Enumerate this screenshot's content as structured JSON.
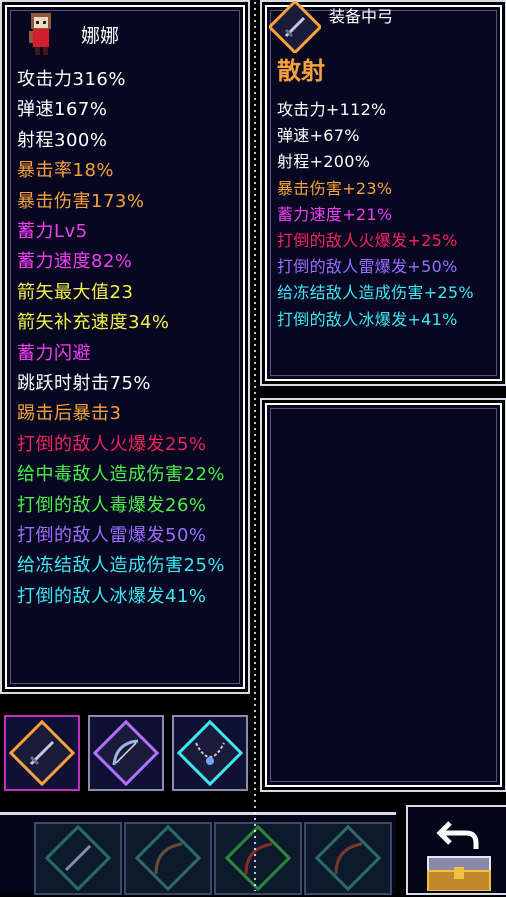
{
  "character": {
    "name": "娜娜",
    "stats": [
      {
        "text": "攻击力316%",
        "color": "#ffffff"
      },
      {
        "text": "弹速167%",
        "color": "#ffffff"
      },
      {
        "text": "射程300%",
        "color": "#ffffff"
      },
      {
        "text": "暴击率18%",
        "color": "#f6a13c"
      },
      {
        "text": "暴击伤害173%",
        "color": "#f6a13c"
      },
      {
        "text": "蓄力Lv5",
        "color": "#f03ef0"
      },
      {
        "text": "蓄力速度82%",
        "color": "#f03ef0"
      },
      {
        "text": "箭矢最大值23",
        "color": "#f4f04a"
      },
      {
        "text": "箭矢补充速度34%",
        "color": "#f4f04a"
      },
      {
        "text": "蓄力闪避",
        "color": "#f03ef0"
      },
      {
        "text": "跳跃时射击75%",
        "color": "#ffffff"
      },
      {
        "text": "踢击后暴击3",
        "color": "#f6a13c"
      },
      {
        "text": "打倒的敌人火爆发25%",
        "color": "#f0245a"
      },
      {
        "text": "给中毒敌人造成伤害22%",
        "color": "#4cf04a"
      },
      {
        "text": "打倒的敌人毒爆发26%",
        "color": "#4cf04a"
      },
      {
        "text": "打倒的敌人雷爆发50%",
        "color": "#9a6cff"
      },
      {
        "text": "给冻结敌人造成伤害25%",
        "color": "#3ee6ee"
      },
      {
        "text": "打倒的敌人冰爆发41%",
        "color": "#3ee6ee"
      }
    ]
  },
  "equipped": {
    "label": "装备中弓",
    "title": "散射",
    "icon": "sword-icon",
    "stats": [
      {
        "text": "攻击力+112%",
        "color": "#ffffff"
      },
      {
        "text": "弹速+67%",
        "color": "#ffffff"
      },
      {
        "text": "射程+200%",
        "color": "#ffffff"
      },
      {
        "text": "暴击伤害+23%",
        "color": "#f6a13c"
      },
      {
        "text": "蓄力速度+21%",
        "color": "#f03ef0"
      },
      {
        "text": "打倒的敌人火爆发+25%",
        "color": "#f0245a"
      },
      {
        "text": "打倒的敌人雷爆发+50%",
        "color": "#9a6cff"
      },
      {
        "text": "给冻结敌人造成伤害+25%",
        "color": "#3ee6ee"
      },
      {
        "text": "打倒的敌人冰爆发+41%",
        "color": "#3ee6ee"
      }
    ]
  },
  "equipment_slots": [
    {
      "icon": "sword-icon",
      "border": "#f6a13c",
      "frame": "#c030c0"
    },
    {
      "icon": "bow-icon",
      "border": "#b070ff",
      "frame": "#8c8cae"
    },
    {
      "icon": "necklace-icon",
      "border": "#3ee6ee",
      "frame": "#8c8cae"
    }
  ],
  "inventory": [
    {
      "icon": "sword-icon"
    },
    {
      "icon": "bow-icon"
    },
    {
      "icon": "bow-icon"
    },
    {
      "icon": "bow-icon"
    }
  ],
  "side": {
    "icon": "back-arrow-icon",
    "chest": "treasure-chest-icon"
  }
}
